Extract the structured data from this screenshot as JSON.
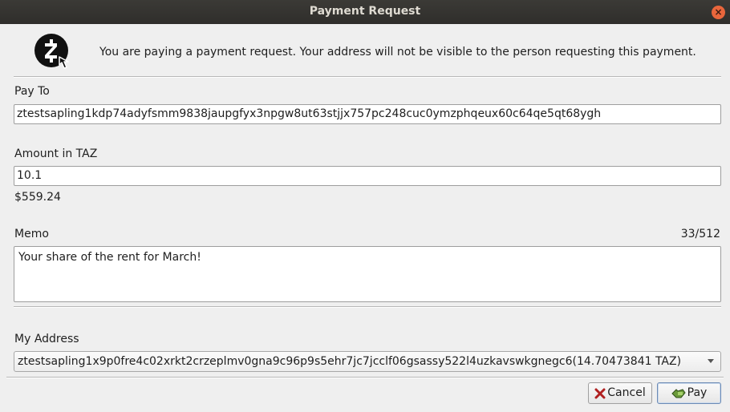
{
  "window": {
    "title": "Payment Request",
    "close_icon": "×"
  },
  "info": {
    "icon": "zcash-pay-icon",
    "text": "You are paying a payment request. Your address will not be visible to the person requesting this payment."
  },
  "pay_to": {
    "label": "Pay To",
    "value": "ztestsapling1kdp74adyfsmm9838jaupgfyx3npgw8ut63stjjx757pc248cuc0ymzphqeux60c64qe5qt68ygh"
  },
  "amount": {
    "label": "Amount in TAZ",
    "value": "10.1",
    "fiat": "$559.24"
  },
  "memo": {
    "label": "Memo",
    "count": "33/512",
    "value": "Your share of the rent for March!"
  },
  "my_address": {
    "label": "My Address",
    "selected": "ztestsapling1x9p0fre4c02xrkt2crzeplmv0gna9c96p9s5ehr7jc7jcclf06gsassy522l4uzkavswkgnegc6(14.70473841 TAZ)"
  },
  "buttons": {
    "cancel": "Cancel",
    "pay": "Pay"
  },
  "colors": {
    "titlebar": "#2f2e2b",
    "close": "#e9663c",
    "background": "#efefef"
  }
}
